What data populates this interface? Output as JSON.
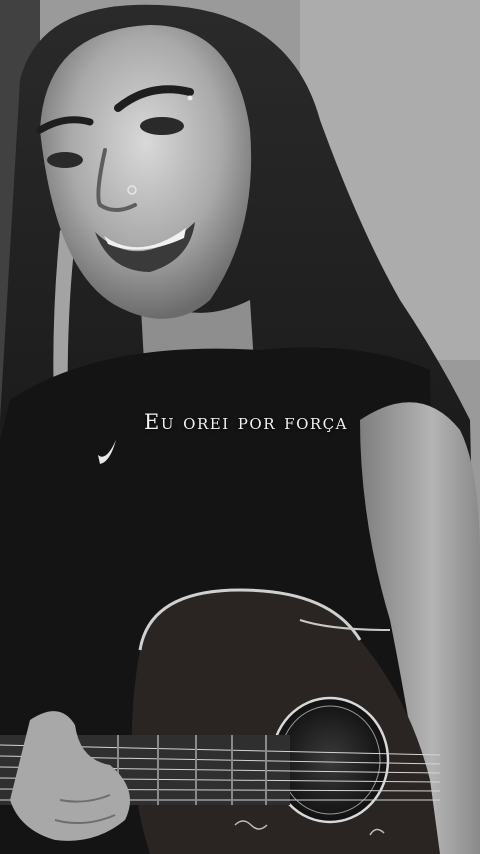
{
  "caption": {
    "text": "Eu orei por força"
  },
  "photo": {
    "style": "black-and-white selfie",
    "subject": "smiling girl with long dark hair holding an acoustic guitar"
  },
  "colors": {
    "caption_text": "#f2f2f2",
    "shirt": "#141414",
    "guitar_body": "#2a2522"
  }
}
